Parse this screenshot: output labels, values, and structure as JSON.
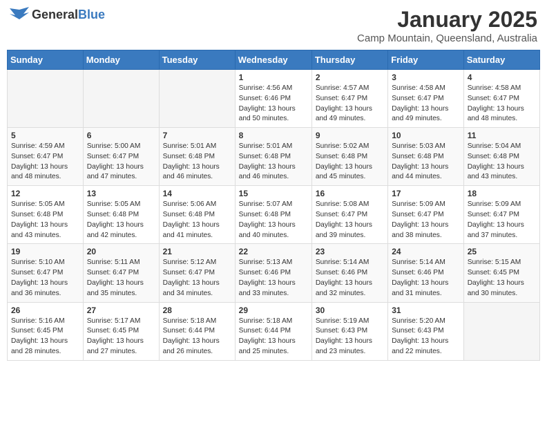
{
  "logo": {
    "general": "General",
    "blue": "Blue"
  },
  "title": "January 2025",
  "subtitle": "Camp Mountain, Queensland, Australia",
  "weekdays": [
    "Sunday",
    "Monday",
    "Tuesday",
    "Wednesday",
    "Thursday",
    "Friday",
    "Saturday"
  ],
  "weeks": [
    [
      {
        "day": "",
        "info": ""
      },
      {
        "day": "",
        "info": ""
      },
      {
        "day": "",
        "info": ""
      },
      {
        "day": "1",
        "info": "Sunrise: 4:56 AM\nSunset: 6:46 PM\nDaylight: 13 hours\nand 50 minutes."
      },
      {
        "day": "2",
        "info": "Sunrise: 4:57 AM\nSunset: 6:47 PM\nDaylight: 13 hours\nand 49 minutes."
      },
      {
        "day": "3",
        "info": "Sunrise: 4:58 AM\nSunset: 6:47 PM\nDaylight: 13 hours\nand 49 minutes."
      },
      {
        "day": "4",
        "info": "Sunrise: 4:58 AM\nSunset: 6:47 PM\nDaylight: 13 hours\nand 48 minutes."
      }
    ],
    [
      {
        "day": "5",
        "info": "Sunrise: 4:59 AM\nSunset: 6:47 PM\nDaylight: 13 hours\nand 48 minutes."
      },
      {
        "day": "6",
        "info": "Sunrise: 5:00 AM\nSunset: 6:47 PM\nDaylight: 13 hours\nand 47 minutes."
      },
      {
        "day": "7",
        "info": "Sunrise: 5:01 AM\nSunset: 6:48 PM\nDaylight: 13 hours\nand 46 minutes."
      },
      {
        "day": "8",
        "info": "Sunrise: 5:01 AM\nSunset: 6:48 PM\nDaylight: 13 hours\nand 46 minutes."
      },
      {
        "day": "9",
        "info": "Sunrise: 5:02 AM\nSunset: 6:48 PM\nDaylight: 13 hours\nand 45 minutes."
      },
      {
        "day": "10",
        "info": "Sunrise: 5:03 AM\nSunset: 6:48 PM\nDaylight: 13 hours\nand 44 minutes."
      },
      {
        "day": "11",
        "info": "Sunrise: 5:04 AM\nSunset: 6:48 PM\nDaylight: 13 hours\nand 43 minutes."
      }
    ],
    [
      {
        "day": "12",
        "info": "Sunrise: 5:05 AM\nSunset: 6:48 PM\nDaylight: 13 hours\nand 43 minutes."
      },
      {
        "day": "13",
        "info": "Sunrise: 5:05 AM\nSunset: 6:48 PM\nDaylight: 13 hours\nand 42 minutes."
      },
      {
        "day": "14",
        "info": "Sunrise: 5:06 AM\nSunset: 6:48 PM\nDaylight: 13 hours\nand 41 minutes."
      },
      {
        "day": "15",
        "info": "Sunrise: 5:07 AM\nSunset: 6:48 PM\nDaylight: 13 hours\nand 40 minutes."
      },
      {
        "day": "16",
        "info": "Sunrise: 5:08 AM\nSunset: 6:47 PM\nDaylight: 13 hours\nand 39 minutes."
      },
      {
        "day": "17",
        "info": "Sunrise: 5:09 AM\nSunset: 6:47 PM\nDaylight: 13 hours\nand 38 minutes."
      },
      {
        "day": "18",
        "info": "Sunrise: 5:09 AM\nSunset: 6:47 PM\nDaylight: 13 hours\nand 37 minutes."
      }
    ],
    [
      {
        "day": "19",
        "info": "Sunrise: 5:10 AM\nSunset: 6:47 PM\nDaylight: 13 hours\nand 36 minutes."
      },
      {
        "day": "20",
        "info": "Sunrise: 5:11 AM\nSunset: 6:47 PM\nDaylight: 13 hours\nand 35 minutes."
      },
      {
        "day": "21",
        "info": "Sunrise: 5:12 AM\nSunset: 6:47 PM\nDaylight: 13 hours\nand 34 minutes."
      },
      {
        "day": "22",
        "info": "Sunrise: 5:13 AM\nSunset: 6:46 PM\nDaylight: 13 hours\nand 33 minutes."
      },
      {
        "day": "23",
        "info": "Sunrise: 5:14 AM\nSunset: 6:46 PM\nDaylight: 13 hours\nand 32 minutes."
      },
      {
        "day": "24",
        "info": "Sunrise: 5:14 AM\nSunset: 6:46 PM\nDaylight: 13 hours\nand 31 minutes."
      },
      {
        "day": "25",
        "info": "Sunrise: 5:15 AM\nSunset: 6:45 PM\nDaylight: 13 hours\nand 30 minutes."
      }
    ],
    [
      {
        "day": "26",
        "info": "Sunrise: 5:16 AM\nSunset: 6:45 PM\nDaylight: 13 hours\nand 28 minutes."
      },
      {
        "day": "27",
        "info": "Sunrise: 5:17 AM\nSunset: 6:45 PM\nDaylight: 13 hours\nand 27 minutes."
      },
      {
        "day": "28",
        "info": "Sunrise: 5:18 AM\nSunset: 6:44 PM\nDaylight: 13 hours\nand 26 minutes."
      },
      {
        "day": "29",
        "info": "Sunrise: 5:18 AM\nSunset: 6:44 PM\nDaylight: 13 hours\nand 25 minutes."
      },
      {
        "day": "30",
        "info": "Sunrise: 5:19 AM\nSunset: 6:43 PM\nDaylight: 13 hours\nand 23 minutes."
      },
      {
        "day": "31",
        "info": "Sunrise: 5:20 AM\nSunset: 6:43 PM\nDaylight: 13 hours\nand 22 minutes."
      },
      {
        "day": "",
        "info": ""
      }
    ]
  ]
}
